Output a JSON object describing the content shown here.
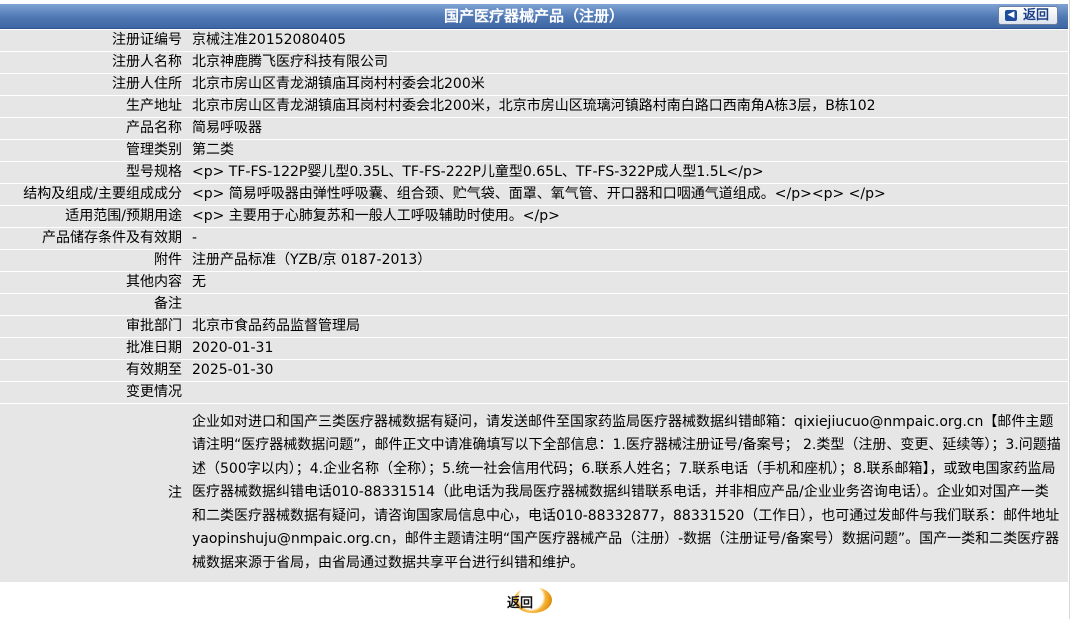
{
  "header": {
    "title": "国产医疗器械产品（注册）",
    "back_label": "返回"
  },
  "rows": [
    {
      "label": "注册证编号",
      "value": "京械注准20152080405"
    },
    {
      "label": "注册人名称",
      "value": "北京神鹿腾飞医疗科技有限公司"
    },
    {
      "label": "注册人住所",
      "value": "北京市房山区青龙湖镇庙耳岗村村委会北200米"
    },
    {
      "label": "生产地址",
      "value": "北京市房山区青龙湖镇庙耳岗村村委会北200米，北京市房山区琉璃河镇路村南白路口西南角A栋3层，B栋102"
    },
    {
      "label": "产品名称",
      "value": "简易呼吸器"
    },
    {
      "label": "管理类别",
      "value": "第二类"
    },
    {
      "label": "型号规格",
      "value": "<p> TF-FS-122P婴儿型0.35L、TF-FS-222P儿童型0.65L、TF-FS-322P成人型1.5L</p>"
    },
    {
      "label": "结构及组成/主要组成成分",
      "value": "<p> 简易呼吸器由弹性呼吸囊、组合颈、贮气袋、面罩、氧气管、开口器和口咽通气道组成。</p><p> </p>"
    },
    {
      "label": "适用范围/预期用途",
      "value": "<p> 主要用于心肺复苏和一般人工呼吸辅助时使用。</p>"
    },
    {
      "label": "产品储存条件及有效期",
      "value": "-"
    },
    {
      "label": "附件",
      "value": "注册产品标准（YZB/京 0187-2013）"
    },
    {
      "label": "其他内容",
      "value": "无"
    },
    {
      "label": "备注",
      "value": ""
    },
    {
      "label": "审批部门",
      "value": "北京市食品药品监督管理局"
    },
    {
      "label": "批准日期",
      "value": "2020-01-31"
    },
    {
      "label": "有效期至",
      "value": "2025-01-30"
    },
    {
      "label": "变更情况",
      "value": ""
    }
  ],
  "note": {
    "label": "注",
    "text": "企业如对进口和国产三类医疗器械数据有疑问，请发送邮件至国家药监局医疗器械数据纠错邮箱：qixiejiucuo@nmpaic.org.cn【邮件主题请注明“医疗器械数据问题”，邮件正文中请准确填写以下全部信息：1.医疗器械注册证号/备案号； 2.类型（注册、变更、延续等）；3.问题描述（500字以内）；4.企业名称（全称）；5.统一社会信用代码；6.联系人姓名；7.联系电话（手机和座机）；8.联系邮箱】，或致电国家药监局医疗器械数据纠错电话010-88331514（此电话为我局医疗器械数据纠错联系电话，并非相应产品/企业业务咨询电话）。企业如对国产一类和二类医疗器械数据有疑问，请咨询国家局信息中心，电话010-88332877，88331520（工作日），也可通过发邮件与我们联系：邮件地址yaopinshuju@nmpaic.org.cn，邮件主题请注明“国产医疗器械产品（注册）-数据（注册证号/备案号）数据问题”。国产一类和二类医疗器械数据来源于省局，由省局通过数据共享平台进行纠错和维护。"
  },
  "footer": {
    "back_label": "返回"
  }
}
